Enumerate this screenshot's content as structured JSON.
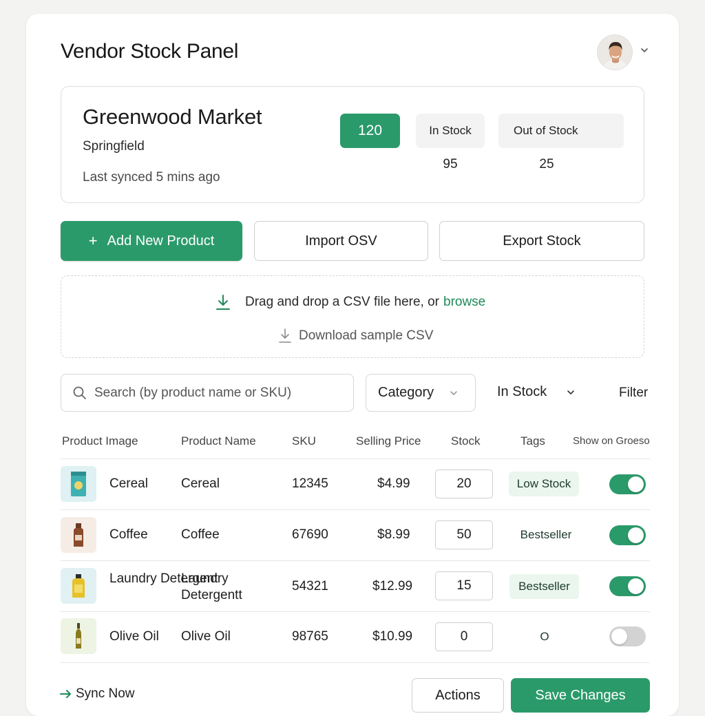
{
  "header": {
    "title": "Vendor Stock Panel"
  },
  "store": {
    "name": "Greenwood Market",
    "city": "Springfield",
    "last_synced": "Last synced 5 mins ago",
    "total": "120",
    "in_stock_label": "In Stock",
    "in_stock_count": "95",
    "out_of_stock_label": "Out of Stock",
    "out_of_stock_count": "25"
  },
  "actions": {
    "add_label": "Add New Product",
    "import_label": "Import OSV",
    "export_label": "Export Stock"
  },
  "dropzone": {
    "text": "Drag and drop a CSV file here, or",
    "browse": "browse",
    "sample": "Download sample CSV"
  },
  "filters": {
    "search_placeholder": "Search (by product name or SKU)",
    "category": "Category",
    "stock_status": "In Stock",
    "filter_label": "Filter"
  },
  "table": {
    "headers": [
      "Product Image",
      "Product Name",
      "SKU",
      "Selling Price",
      "Stock",
      "Tags",
      "Show on Groeso"
    ],
    "rows": [
      {
        "image_label": "Cereal",
        "name": "Cereal",
        "sku": "12345",
        "price": "$4.99",
        "stock": "20",
        "tag": "Low Stock",
        "visible": true
      },
      {
        "image_label": "Coffee",
        "name": "Coffee",
        "sku": "67690",
        "price": "$8.99",
        "stock": "50",
        "tag": "Bestseller",
        "visible": true
      },
      {
        "image_label": "Laundry Detergent",
        "name": "Laundry Detergentt",
        "sku": "54321",
        "price": "$12.99",
        "stock": "15",
        "tag": "Bestseller",
        "visible": true
      },
      {
        "image_label": "Olive Oil",
        "name": "Olive Oil",
        "sku": "98765",
        "price": "$10.99",
        "stock": "0",
        "tag": "O",
        "visible": false
      }
    ]
  },
  "footer": {
    "sync_label": "Sync Now",
    "actions_label": "Actions",
    "save_label": "Save Changes"
  },
  "icons": {
    "avatar": "user-avatar",
    "upload": "download-arrow-icon",
    "search": "search-icon",
    "chevron": "chevron-down-icon",
    "sync": "arrow-right-icon"
  },
  "colors": {
    "accent": "#2b9a6a",
    "tag_bg": "#eaf6ee",
    "link": "#1f8a59"
  }
}
